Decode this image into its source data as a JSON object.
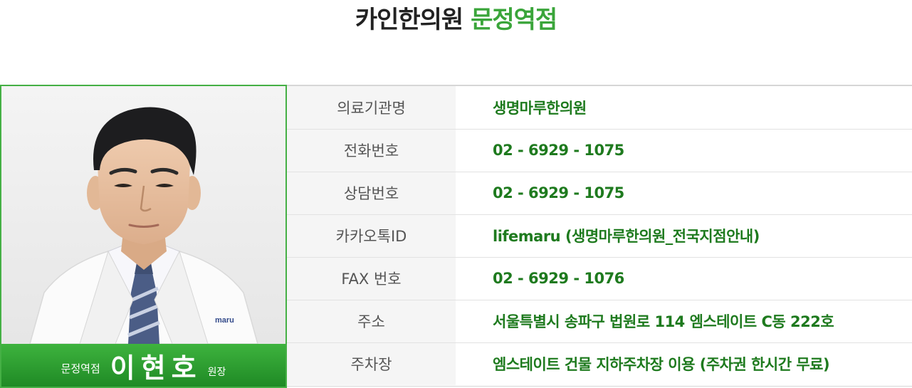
{
  "header": {
    "clinic_name": "카인한의원",
    "branch_name": "문정역점"
  },
  "doctor": {
    "branch_label": "문정역점",
    "name": "이현호",
    "role": "원장",
    "coat_logo_text": "maru"
  },
  "info_rows": [
    {
      "label": "의료기관명",
      "value": "생명마루한의원"
    },
    {
      "label": "전화번호",
      "value": "02 - 6929 - 1075"
    },
    {
      "label": "상담번호",
      "value": "02 - 6929 - 1075"
    },
    {
      "label": "카카오톡ID",
      "value": "lifemaru (생명마루한의원_전국지점안내)"
    },
    {
      "label": "FAX 번호",
      "value": "02 - 6929 - 1076"
    },
    {
      "label": "주소",
      "value": "서울특별시 송파구 법원로 114 엠스테이트 C동 222호"
    },
    {
      "label": "주차장",
      "value": "엠스테이트 건물 지하주차장 이용 (주차권 한시간 무료)"
    }
  ],
  "colors": {
    "accent_green": "#3aa53a",
    "value_green": "#1e7a1e",
    "caption_green": "#2f9e30"
  }
}
